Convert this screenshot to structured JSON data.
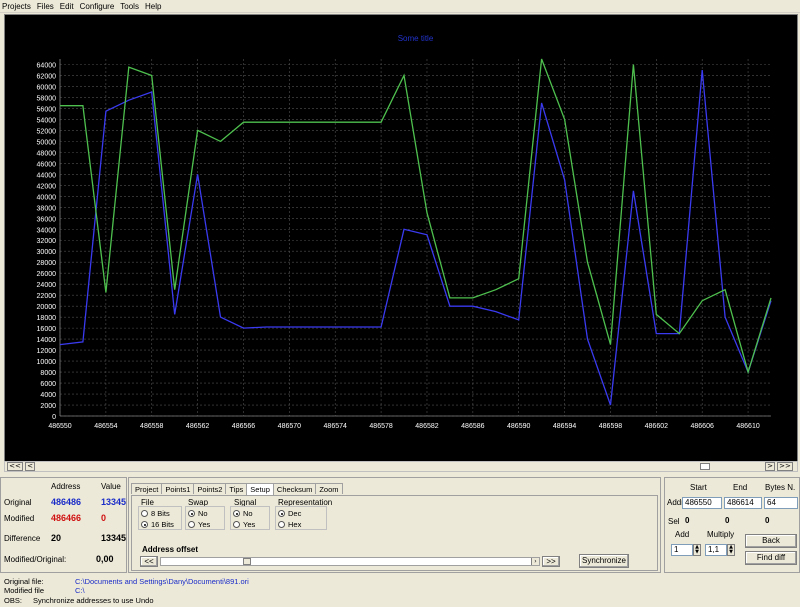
{
  "menu": [
    "Projects",
    "Files",
    "Edit",
    "Configure",
    "Tools",
    "Help"
  ],
  "chart_data": {
    "type": "line",
    "title": "Some title",
    "ylim": [
      0,
      65000
    ],
    "xlim": [
      486550,
      486612
    ],
    "x_ticks": [
      486550,
      486554,
      486558,
      486562,
      486566,
      486570,
      486574,
      486578,
      486582,
      486586,
      486590,
      486594,
      486598,
      486602,
      486606,
      486610
    ],
    "y_ticks": [
      0,
      2000,
      4000,
      6000,
      8000,
      10000,
      12000,
      14000,
      16000,
      18000,
      20000,
      22000,
      24000,
      26000,
      28000,
      30000,
      32000,
      34000,
      36000,
      38000,
      40000,
      42000,
      44000,
      46000,
      48000,
      50000,
      52000,
      54000,
      56000,
      58000,
      60000,
      62000,
      64000
    ],
    "grid": true,
    "series": [
      {
        "color": "#3a3af0",
        "x": [
          486550,
          486552,
          486554,
          486556,
          486558,
          486560,
          486562,
          486564,
          486566,
          486568,
          486570,
          486572,
          486574,
          486576,
          486578,
          486580,
          486582,
          486584,
          486586,
          486588,
          486590,
          486592,
          486594,
          486596,
          486598,
          486600,
          486602,
          486604,
          486606,
          486608,
          486610,
          486612
        ],
        "y": [
          13000,
          13500,
          55500,
          57500,
          59000,
          18500,
          44000,
          18000,
          16000,
          16200,
          16200,
          16200,
          16200,
          16200,
          16200,
          34000,
          33000,
          20000,
          20000,
          19000,
          17500,
          57000,
          43000,
          14000,
          2000,
          41000,
          15000,
          15000,
          63000,
          18000,
          8000,
          21000
        ]
      },
      {
        "color": "#4ec04e",
        "x": [
          486550,
          486552,
          486554,
          486556,
          486558,
          486560,
          486562,
          486564,
          486566,
          486568,
          486570,
          486572,
          486574,
          486576,
          486578,
          486580,
          486582,
          486584,
          486586,
          486588,
          486590,
          486592,
          486594,
          486596,
          486598,
          486600,
          486602,
          486604,
          486606,
          486608,
          486610,
          486612
        ],
        "y": [
          56500,
          56500,
          22500,
          63500,
          62000,
          23000,
          52000,
          50000,
          53500,
          53500,
          53500,
          53500,
          53500,
          53500,
          53500,
          62000,
          37000,
          21500,
          21500,
          23000,
          25000,
          65000,
          54000,
          28000,
          13000,
          64000,
          18500,
          15000,
          21000,
          23000,
          8000,
          21500
        ]
      }
    ]
  },
  "scroll": {
    "left_fast": "<<",
    "left": "<",
    "right": ">",
    "right_fast": ">>"
  },
  "left_panel": {
    "col_address": "Address",
    "col_value": "Value",
    "original_label": "Original",
    "original_address": "486486",
    "original_value": "13345",
    "modified_label": "Modified",
    "modified_address": "486466",
    "modified_value": "0",
    "difference_label": "Difference",
    "difference_address": "20",
    "difference_value": "13345",
    "ratio_label": "Modified/Original:",
    "ratio_value": "0,00"
  },
  "tabs": [
    "Project",
    "Points1",
    "Points2",
    "Tips",
    "Setup",
    "Checksum",
    "Zoom"
  ],
  "setup": {
    "file_label": "File",
    "file_opt1": "8 Bits",
    "file_opt2": "16 Bits",
    "swap_label": "Swap",
    "swap_opt1": "No",
    "swap_opt2": "Yes",
    "signal_label": "Signal",
    "signal_opt1": "No",
    "signal_opt2": "Yes",
    "repr_label": "Representation",
    "repr_opt1": "Dec",
    "repr_opt2": "Hex",
    "offset_label": "Address offset",
    "offset_left": "<<",
    "offset_right": ">>",
    "sync_button": "Synchronize"
  },
  "right_panel": {
    "start_label": "Start",
    "end_label": "End",
    "bytes_label": "Bytes N.",
    "addr_label": "Addr",
    "start_value": "486550",
    "end_value": "486614",
    "bytes_value": "64",
    "sel_label": "Sel",
    "sel_start": "0",
    "sel_end": "0",
    "sel_bytes": "0",
    "add_label": "Add",
    "multiply_label": "Multiply",
    "add_value": "1",
    "multiply_value": "1,1",
    "back_button": "Back",
    "find_diff_button": "Find diff"
  },
  "status": {
    "original_file_label": "Original file:",
    "original_file_value": "C:\\Documents and Settings\\Dany\\Documenti\\891.ori",
    "modified_file_label": "Modified file",
    "modified_file_value": "C:\\",
    "obs_label": "OBS:",
    "obs_value": "Synchronize addresses to use Undo"
  }
}
